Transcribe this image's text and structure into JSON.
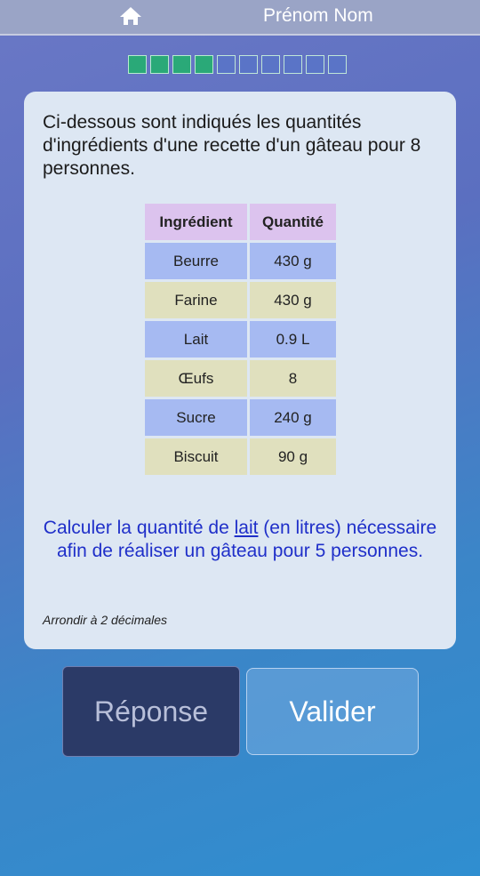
{
  "header": {
    "home_icon": "home-icon",
    "username": "Prénom Nom"
  },
  "progress": {
    "total_steps": 10,
    "completed_steps": 4,
    "completed_color": "#2aa978",
    "pending_color": "#5a74c7"
  },
  "exercise": {
    "intro": "Ci-dessous sont indiqués les quantités d'ingrédients d'une recette d'un gâteau pour 8 personnes.",
    "table": {
      "headers": [
        "Ingrédient",
        "Quantité"
      ],
      "rows": [
        [
          "Beurre",
          "430 g"
        ],
        [
          "Farine",
          "430 g"
        ],
        [
          "Lait",
          "0.9 L"
        ],
        [
          "Œufs",
          "8"
        ],
        [
          "Sucre",
          "240 g"
        ],
        [
          "Biscuit",
          "90 g"
        ]
      ]
    },
    "question_before": "Calculer la quantité de ",
    "question_keyword": "lait",
    "question_after": " (en litres) nécessaire afin de réaliser un gâteau pour 5 personnes.",
    "note": "Arrondir à 2 décimales"
  },
  "buttons": {
    "answer_label": "Réponse",
    "validate_label": "Valider"
  },
  "colors": {
    "question_text": "#1f2fc9",
    "header_row": "#dcc3ee",
    "row_blue": "#a6baf2",
    "row_khaki": "#e0e0be"
  }
}
